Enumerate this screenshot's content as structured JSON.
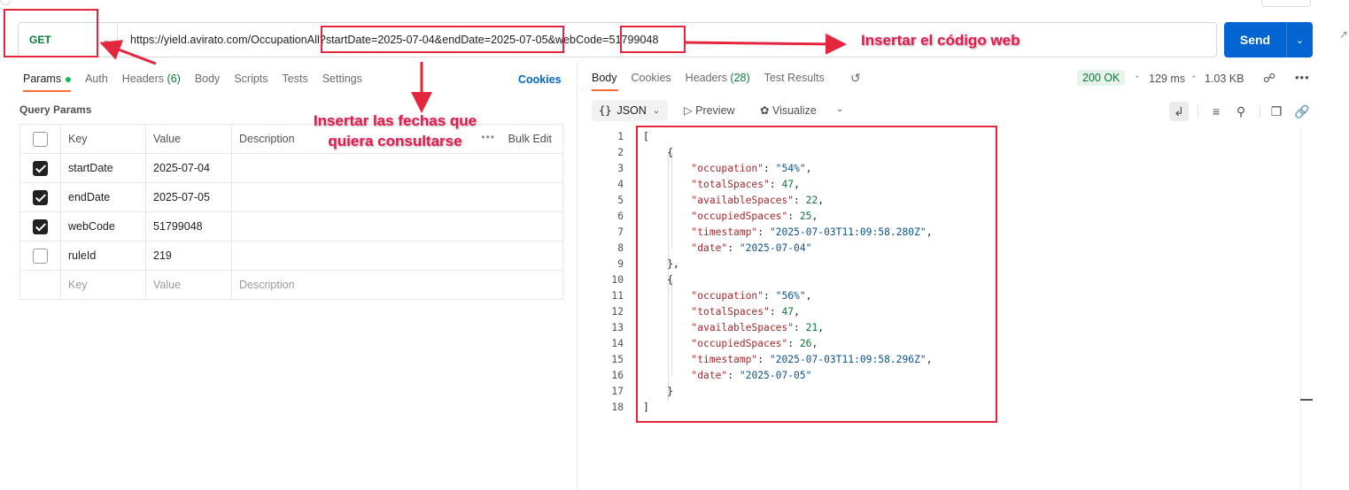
{
  "request": {
    "method": "GET",
    "url": "https://yield.avirato.com/OccupationAll?startDate=2025-07-04&endDate=2025-07-05&webCode=51799048",
    "send_label": "Send"
  },
  "request_tabs": {
    "params": "Params",
    "auth": "Auth",
    "headers": "Headers",
    "headers_count": "(6)",
    "body": "Body",
    "scripts": "Scripts",
    "tests": "Tests",
    "settings": "Settings",
    "cookies": "Cookies"
  },
  "query_params": {
    "title": "Query Params",
    "headers": {
      "key": "Key",
      "value": "Value",
      "description": "Description",
      "bulk_edit": "Bulk Edit"
    },
    "rows": [
      {
        "enabled": true,
        "key": "startDate",
        "value": "2025-07-04"
      },
      {
        "enabled": true,
        "key": "endDate",
        "value": "2025-07-05"
      },
      {
        "enabled": true,
        "key": "webCode",
        "value": "51799048"
      },
      {
        "enabled": false,
        "key": "ruleId",
        "value": "219"
      }
    ],
    "placeholder": {
      "key": "Key",
      "value": "Value",
      "description": "Description"
    }
  },
  "response_tabs": {
    "body": "Body",
    "cookies": "Cookies",
    "headers": "Headers",
    "headers_count": "(28)",
    "test_results": "Test Results"
  },
  "response_meta": {
    "status": "200 OK",
    "time": "129 ms",
    "size": "1.03 KB"
  },
  "response_toolbar": {
    "format": "JSON",
    "preview": "Preview",
    "visualize": "Visualize"
  },
  "response_body": {
    "line_numbers": [
      "1",
      "2",
      "3",
      "4",
      "5",
      "6",
      "7",
      "8",
      "9",
      "10",
      "11",
      "12",
      "13",
      "14",
      "15",
      "16",
      "17",
      "18"
    ],
    "items": [
      {
        "occupation": "\"54%\"",
        "totalSpaces": "47",
        "availableSpaces": "22",
        "occupiedSpaces": "25",
        "timestamp": "\"2025-07-03T11:09:58.280Z\"",
        "date": "\"2025-07-04\""
      },
      {
        "occupation": "\"56%\"",
        "totalSpaces": "47",
        "availableSpaces": "21",
        "occupiedSpaces": "26",
        "timestamp": "\"2025-07-03T11:09:58.296Z\"",
        "date": "\"2025-07-05\""
      }
    ],
    "keys": {
      "occupation": "\"occupation\"",
      "totalSpaces": "\"totalSpaces\"",
      "availableSpaces": "\"availableSpaces\"",
      "occupiedSpaces": "\"occupiedSpaces\"",
      "timestamp": "\"timestamp\"",
      "date": "\"date\""
    }
  },
  "annotations": {
    "web_code": "Insertar el código web",
    "dates_line1": "Insertar las fechas que",
    "dates_line2": "quiera consultarse",
    "color": "#e4263e"
  },
  "icons": {
    "method_chevron": "chevron-down-icon",
    "send_split": "chevron-down-icon",
    "history": "history-icon",
    "globe": "globe-icon",
    "more": "more-horizontal-icon",
    "wrap": "wrap-lines-icon",
    "filter": "filter-icon",
    "search": "search-icon",
    "copy": "copy-icon",
    "link": "link-icon"
  }
}
